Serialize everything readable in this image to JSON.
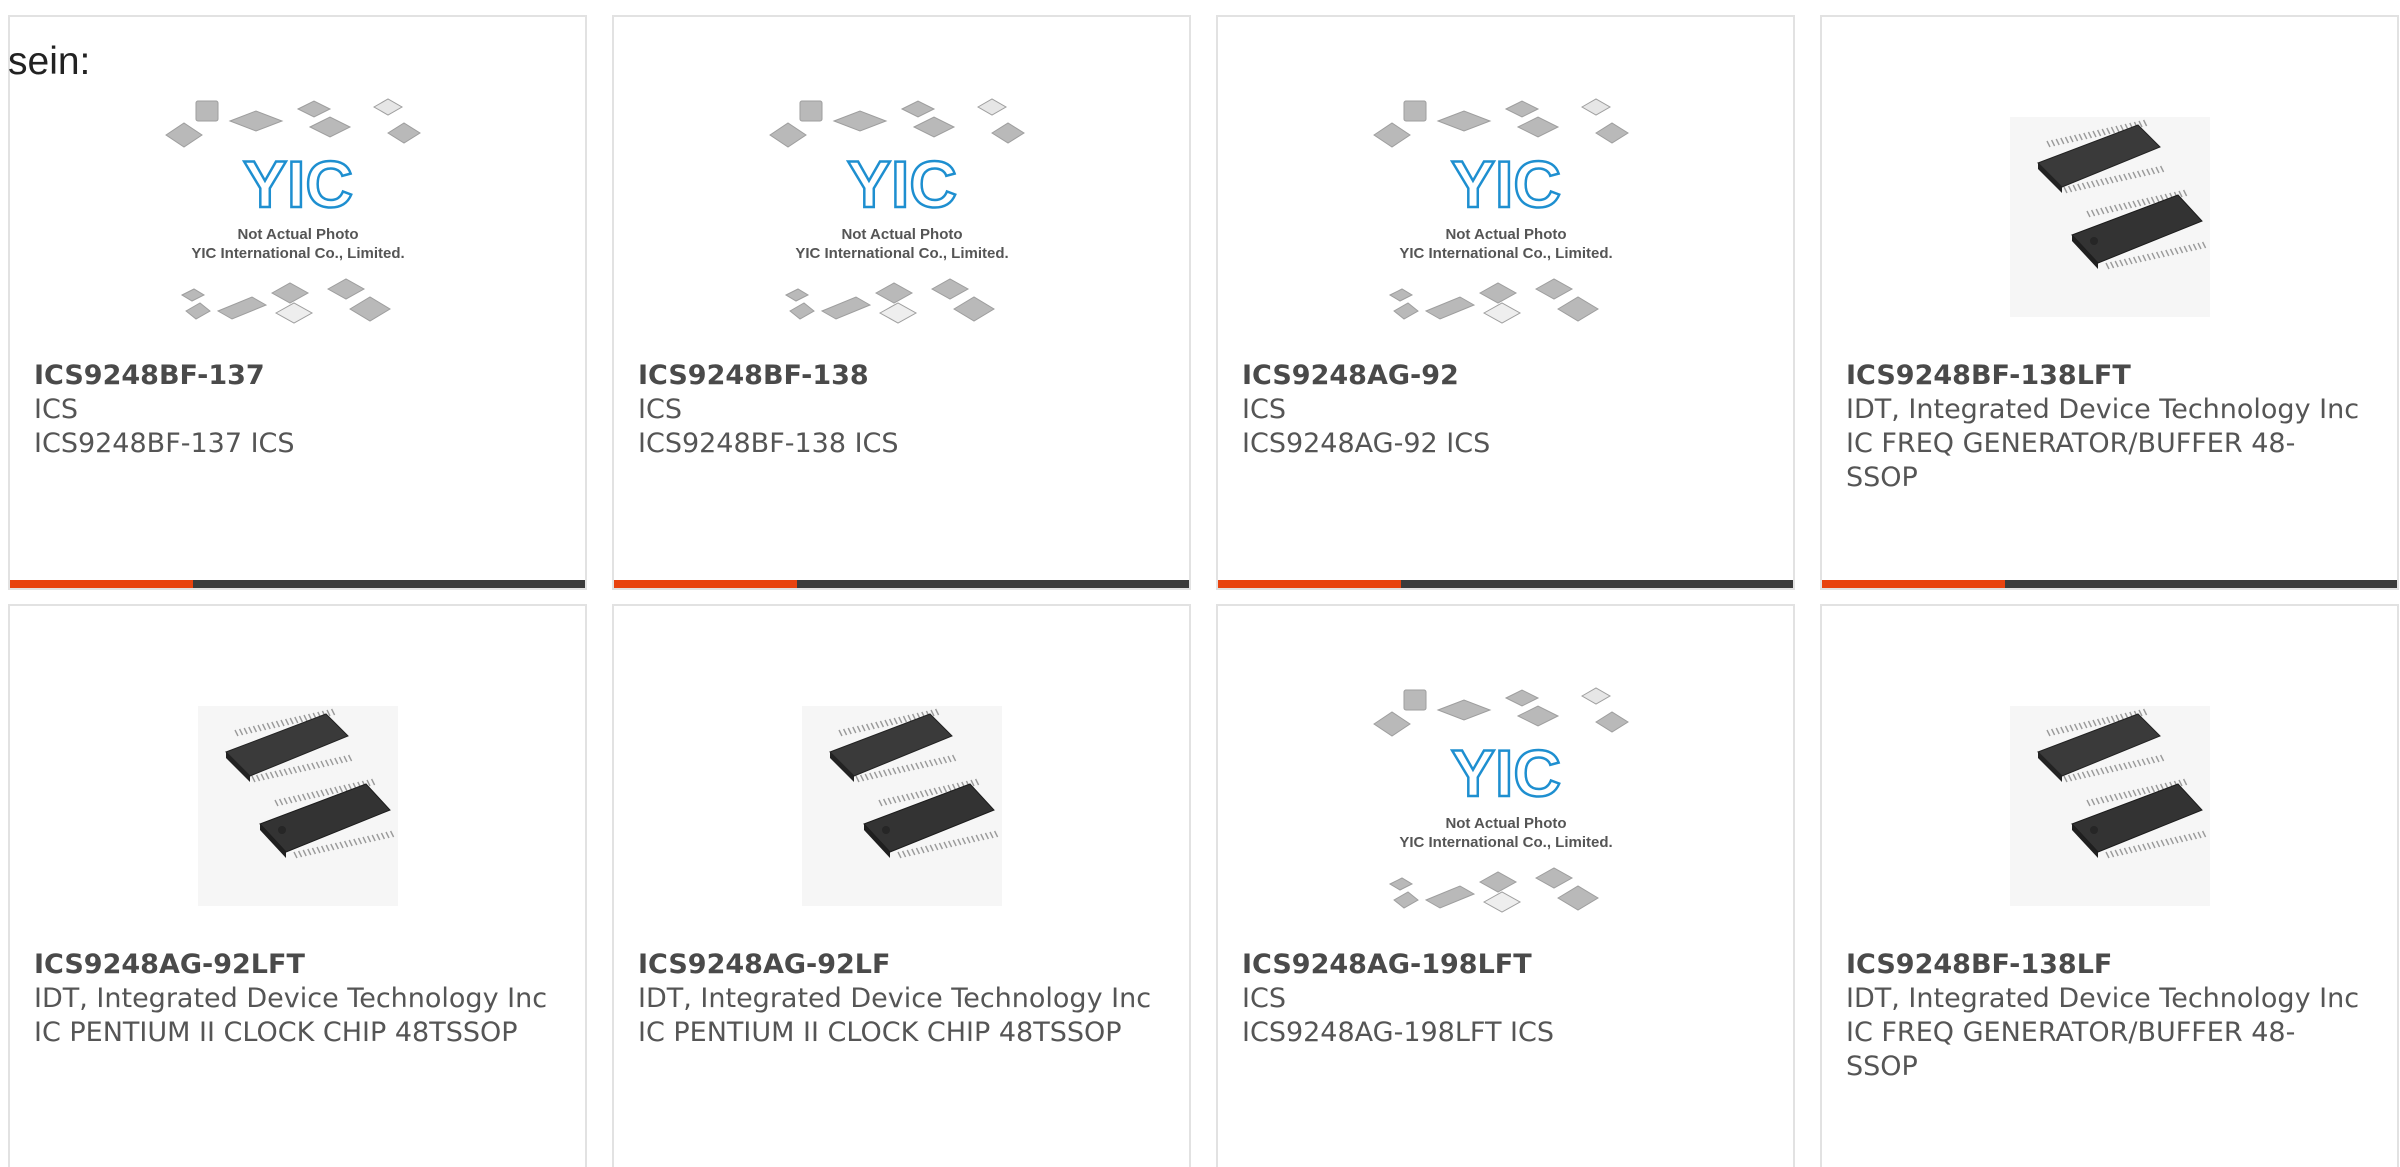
{
  "heading_fragment": "sein:",
  "colors": {
    "accent": "#e8430f",
    "bar": "#3b3b3b",
    "border": "#e2e2e2",
    "logo_blue": "#1e8fd0"
  },
  "placeholder": {
    "logo_text": "YIC",
    "line1": "Not Actual Photo",
    "line2": "YIC International Co., Limited."
  },
  "cards": [
    {
      "part_no": "ICS9248BF-137",
      "maker": "ICS",
      "desc": "ICS9248BF-137 ICS",
      "image": "placeholder",
      "bar_visible": true
    },
    {
      "part_no": "ICS9248BF-138",
      "maker": "ICS",
      "desc": "ICS9248BF-138 ICS",
      "image": "placeholder",
      "bar_visible": true
    },
    {
      "part_no": "ICS9248AG-92",
      "maker": "ICS",
      "desc": "ICS9248AG-92 ICS",
      "image": "placeholder",
      "bar_visible": true
    },
    {
      "part_no": "ICS9248BF-138LFT",
      "maker": "IDT, Integrated Device Technology Inc",
      "desc": "IC FREQ GENERATOR/BUFFER 48-SSOP",
      "image": "chip",
      "bar_visible": true
    },
    {
      "part_no": "ICS9248AG-92LFT",
      "maker": "IDT, Integrated Device Technology Inc",
      "desc": "IC PENTIUM II CLOCK CHIP 48TSSOP",
      "image": "chip",
      "bar_visible": false
    },
    {
      "part_no": "ICS9248AG-92LF",
      "maker": "IDT, Integrated Device Technology Inc",
      "desc": "IC PENTIUM II CLOCK CHIP 48TSSOP",
      "image": "chip",
      "bar_visible": false
    },
    {
      "part_no": "ICS9248AG-198LFT",
      "maker": "ICS",
      "desc": "ICS9248AG-198LFT ICS",
      "image": "placeholder",
      "bar_visible": false
    },
    {
      "part_no": "ICS9248BF-138LF",
      "maker": "IDT, Integrated Device Technology Inc",
      "desc": "IC FREQ GENERATOR/BUFFER 48-SSOP",
      "image": "chip",
      "bar_visible": false
    }
  ]
}
